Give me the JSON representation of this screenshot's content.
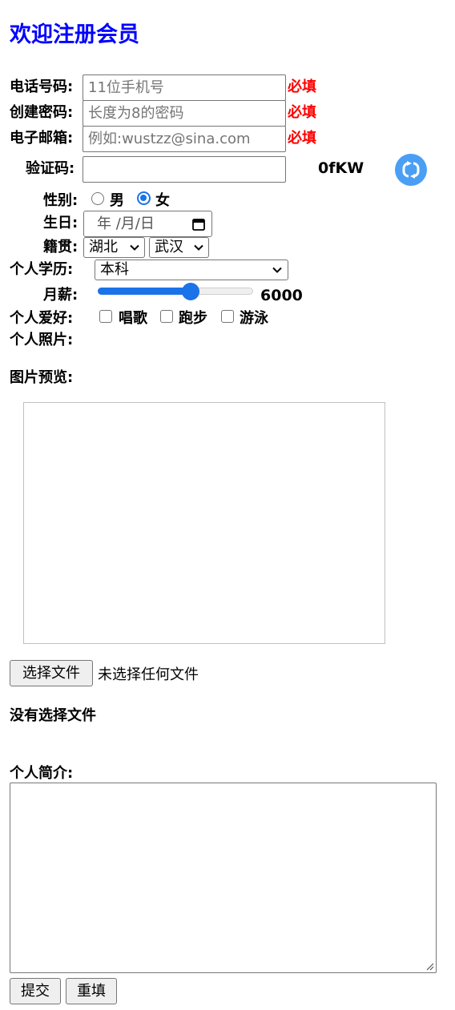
{
  "page_title": "欢迎注册会员",
  "phone": {
    "label": "电话号码:",
    "placeholder": "11位手机号",
    "required": "必填"
  },
  "password": {
    "label": "创建密码:",
    "placeholder": "长度为8的密码",
    "required": "必填"
  },
  "email": {
    "label": "电子邮箱:",
    "placeholder": "例如:wustzz@sina.com",
    "required": "必填"
  },
  "captcha": {
    "label": "验证码:",
    "value": "",
    "code": "0fKW",
    "refresh_icon": "refresh-icon"
  },
  "gender": {
    "label": "性别:",
    "options": [
      "男",
      "女"
    ],
    "selected": "女"
  },
  "birthday": {
    "label": "生日:",
    "placeholder": "年 /月/日",
    "calendar_icon": "calendar-icon"
  },
  "hometown": {
    "label": "籍贯:",
    "province": "湖北",
    "city": "武汉"
  },
  "education": {
    "label": "个人学历:",
    "selected": "本科"
  },
  "salary": {
    "label": "月薪:",
    "value": "6000",
    "slider_fraction": 0.61
  },
  "hobbies": {
    "label": "个人爱好:",
    "options": [
      "唱歌",
      "跑步",
      "游泳"
    ],
    "checked": []
  },
  "photo": {
    "label": "个人照片:",
    "preview_label": "图片预览:",
    "choose_button": "选择文件",
    "no_file_text": "未选择任何文件",
    "status": "没有选择文件"
  },
  "intro": {
    "label": "个人简介:",
    "value": ""
  },
  "actions": {
    "submit": "提交",
    "reset": "重填"
  },
  "colors": {
    "title": "#0000ff",
    "required": "#ff0000",
    "accent": "#1a73e8",
    "refresh_button": "#4a9ff5"
  }
}
